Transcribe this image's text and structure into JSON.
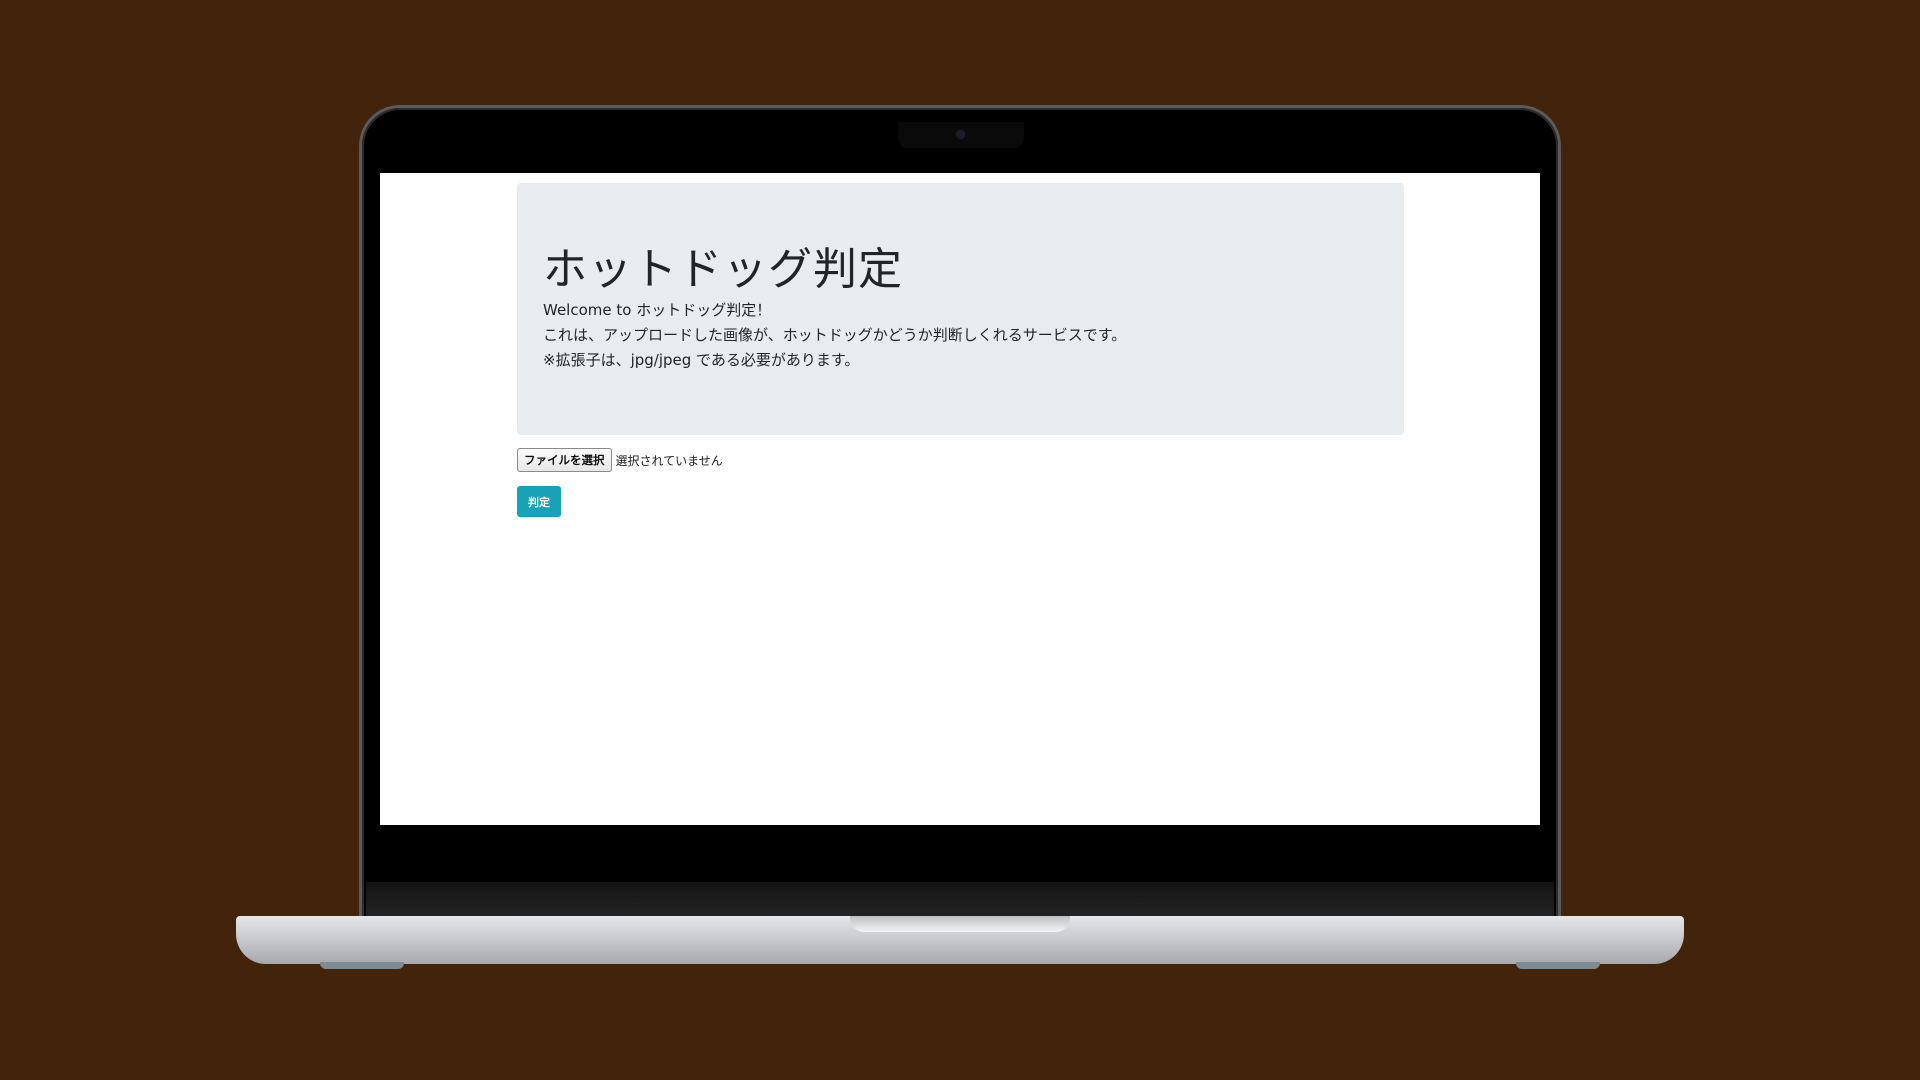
{
  "page": {
    "title": "ホットドッグ判定",
    "lead_lines": [
      "Welcome to ホットドッグ判定！",
      "これは、アップロードした画像が、ホットドッグかどうか判断しくれるサービスです。",
      "※拡張子は、jpg/jpeg である必要があります。"
    ]
  },
  "upload": {
    "file_button_label": "ファイルを選択",
    "file_status": "選択されていません"
  },
  "submit": {
    "label": "判定"
  },
  "colors": {
    "background": "#42230b",
    "jumbotron": "#e9ecef",
    "submit_button": "#17a2b8"
  }
}
